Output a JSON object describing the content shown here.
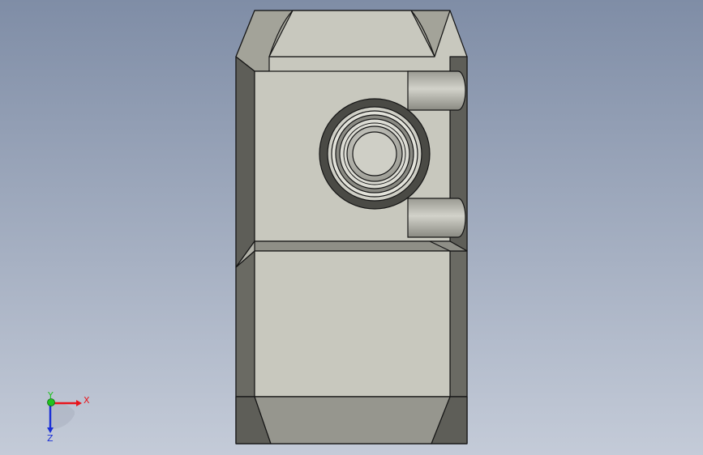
{
  "triad": {
    "x_label": "X",
    "y_label": "Y",
    "z_label": "Z",
    "x_color": "#e8141b",
    "y_color": "#1fc31f",
    "z_color": "#1a2fd6"
  },
  "colors": {
    "background_top": "#7f8da6",
    "background_bottom": "#c4cbd8",
    "face_light": "#c8c8be",
    "face_mid": "#a3a399",
    "face_dark": "#5e5e58",
    "outline": "#151515"
  }
}
